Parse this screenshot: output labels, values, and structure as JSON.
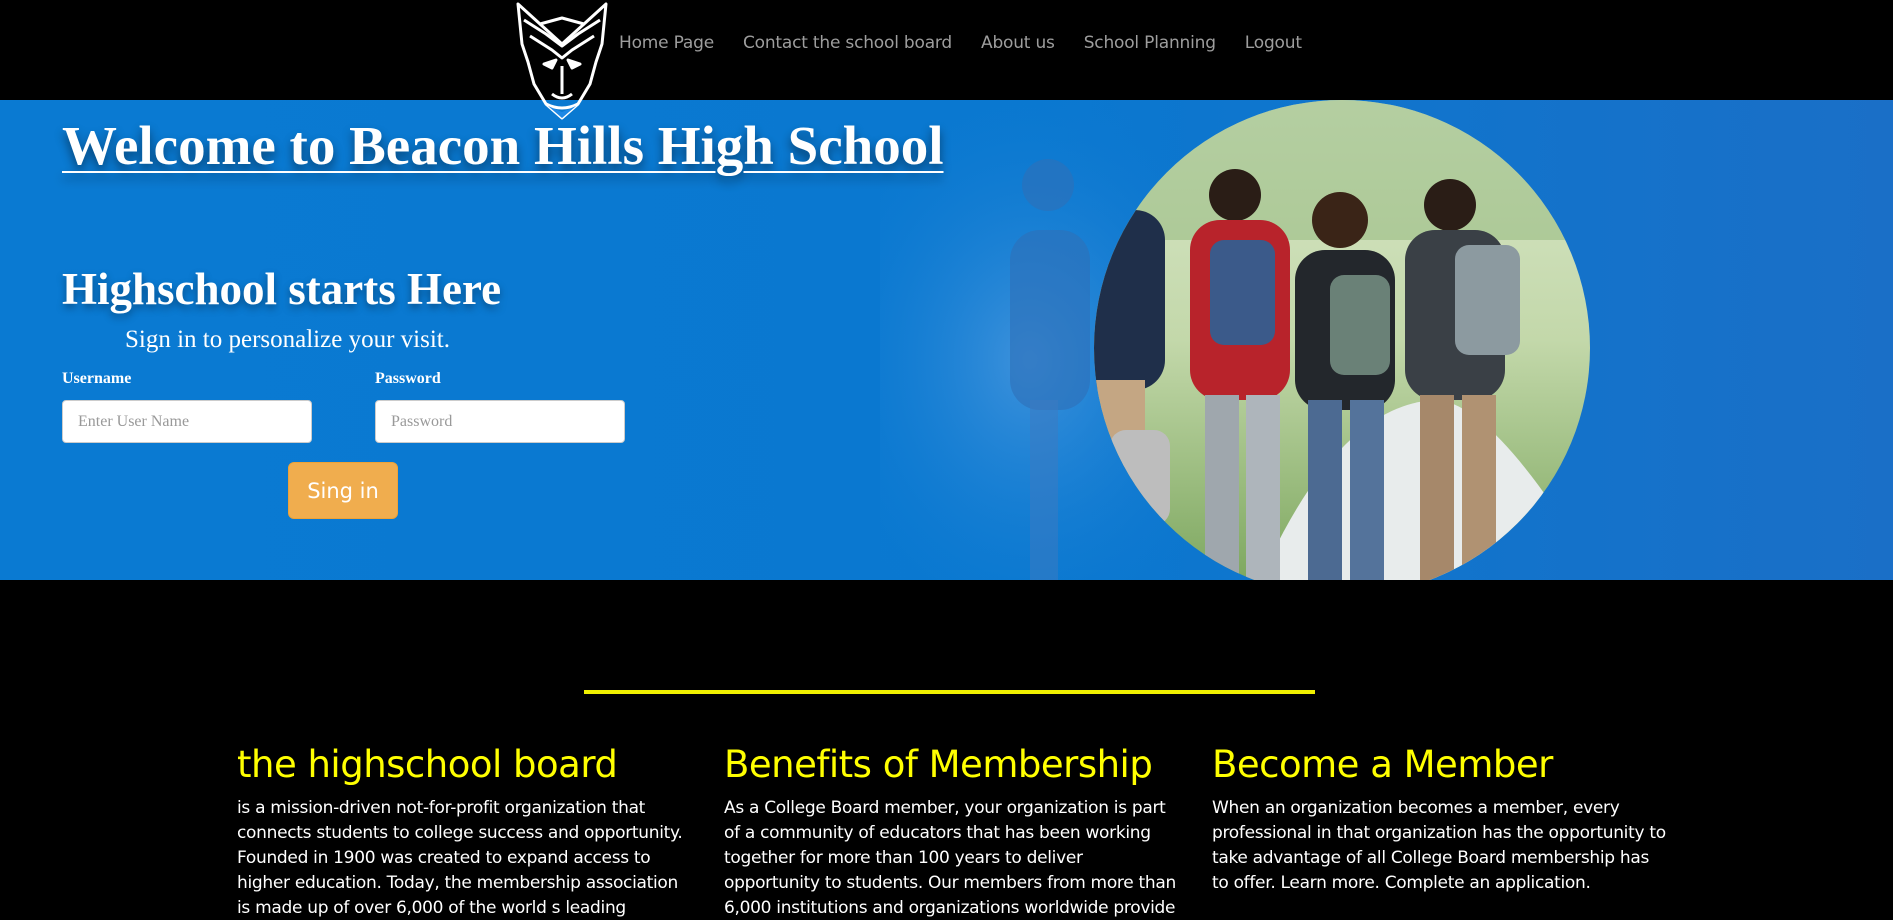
{
  "nav": {
    "logo": "wolf-logo",
    "links": [
      "Home Page",
      "Contact the school board",
      "About us",
      "School Planning",
      "Logout"
    ]
  },
  "hero": {
    "title": "Welcome to Beacon Hills High School",
    "tagline": "Highschool starts Here",
    "subtitle": "Sign in to personalize your visit.",
    "photo": "students-walking-photo"
  },
  "login": {
    "username_label": "Username",
    "username_placeholder": "Enter User Name",
    "password_label": "Password",
    "password_placeholder": "Password",
    "signin_label": "Sing in"
  },
  "columns": [
    {
      "heading": "the highschool board",
      "body": "is a mission-driven not-for-profit organization that connects students to college success and opportunity. Founded in 1900 was created to expand access to higher education. Today, the membership association is made up of over 6,000 of the world s leading"
    },
    {
      "heading": "Benefits of Membership",
      "body": "As a College Board member, your organization is part of a community of educators that has been working together for more than 100 years to deliver opportunity to students. Our members from more than 6,000 institutions and organizations worldwide provide"
    },
    {
      "heading": "Become a Member",
      "body": "When an organization becomes a member, every professional in that organization has the opportunity to take advantage of all College Board membership has to offer. Learn more. Complete an application."
    }
  ],
  "colors": {
    "hero_blue": "#0a7ad2",
    "accent_yellow": "#ffff00",
    "button_orange": "#f0ad4e",
    "nav_text": "#9d9d9d"
  }
}
